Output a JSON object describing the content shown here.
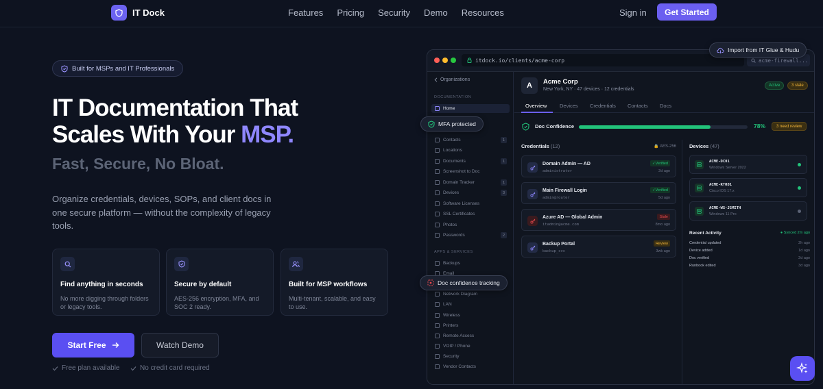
{
  "nav": {
    "brand": "IT Dock",
    "links": [
      "Features",
      "Pricing",
      "Security",
      "Demo",
      "Resources"
    ],
    "signin": "Sign in",
    "cta": "Get Started"
  },
  "hero": {
    "badge": "Built for MSPs and IT Professionals",
    "title_line1": "IT Documentation That",
    "title_line2": "Scales With Your ",
    "title_accent": "MSP.",
    "subtitle": "Fast, Secure, No Bloat.",
    "description": "Organize credentials, devices, SOPs, and client docs in one secure platform — without the complexity of legacy tools.",
    "features": [
      {
        "title": "Find anything in seconds",
        "desc": "No more digging through folders or legacy tools.",
        "icon": "search-icon"
      },
      {
        "title": "Secure by default",
        "desc": "AES-256 encryption, MFA, and SOC 2 ready.",
        "icon": "shield-icon"
      },
      {
        "title": "Built for MSP workflows",
        "desc": "Multi-tenant, scalable, and easy to use.",
        "icon": "users-icon"
      }
    ],
    "start_label": "Start Free",
    "watch_label": "Watch Demo",
    "check1": "Free plan available",
    "check2": "No credit card required"
  },
  "app": {
    "url": "itdock.io/clients/acme-corp",
    "search_placeholder": "acme-firewall...",
    "import_label": "Import from IT Glue & Hudu",
    "mfa_label": "MFA protected",
    "doc_conf_label": "Doc confidence tracking",
    "sidebar": {
      "back": "Organizations",
      "section1": "DOCUMENTATION",
      "section2": "APPS & SERVICES",
      "items1": [
        {
          "label": "Home",
          "count": ""
        },
        {
          "label": "Contacts",
          "count": "1"
        },
        {
          "label": "Locations",
          "count": ""
        },
        {
          "label": "Documents",
          "count": "1"
        },
        {
          "label": "Screenshot to Doc",
          "count": ""
        },
        {
          "label": "Domain Tracker",
          "count": "1"
        },
        {
          "label": "Devices",
          "count": "3"
        },
        {
          "label": "Software Licenses",
          "count": ""
        },
        {
          "label": "SSL Certificates",
          "count": ""
        },
        {
          "label": "Photos",
          "count": ""
        },
        {
          "label": "Passwords",
          "count": "2"
        }
      ],
      "items2": [
        "Backups",
        "Email",
        "Network Diagram",
        "LAN",
        "Wireless",
        "Printers",
        "Remote Access",
        "VOIP / Phone",
        "Security",
        "Vendor Contacts"
      ]
    },
    "org": {
      "avatar": "A",
      "name": "Acme Corp",
      "meta": "New York, NY · 47 devices · 12 credentials",
      "status_active": "Active",
      "status_stale": "3 stale"
    },
    "tabs": [
      "Overview",
      "Devices",
      "Credentials",
      "Contacts",
      "Docs"
    ],
    "confidence": {
      "label": "Doc Confidence",
      "value": 78,
      "value_text": "78%",
      "review": "3 need review"
    },
    "credentials": {
      "title": "Credentials",
      "count": "(12)",
      "aes": "AES-256",
      "rows": [
        {
          "name": "Domain Admin — AD",
          "user": "administrator",
          "status": "Verified",
          "ago": "2d ago"
        },
        {
          "name": "Main Firewall Login",
          "user": "admin@router",
          "status": "Verified",
          "ago": "5d ago"
        },
        {
          "name": "Azure AD — Global Admin",
          "user": "itadmin@acme.com",
          "status": "Stale",
          "ago": "8mo ago"
        },
        {
          "name": "Backup Portal",
          "user": "backup_svc",
          "status": "Review",
          "ago": "3wk ago"
        }
      ]
    },
    "devices": {
      "title": "Devices",
      "count": "(47)",
      "rows": [
        {
          "name": "ACME-DC01",
          "os": "Windows Server 2022",
          "online": true
        },
        {
          "name": "ACME-RTR01",
          "os": "Cisco IOS 17.x",
          "online": true
        },
        {
          "name": "ACME-WS-JSMITH",
          "os": "Windows 11 Pro",
          "online": false
        }
      ]
    },
    "recent": {
      "title": "Recent Activity",
      "sync": "Synced 2m ago",
      "rows": [
        {
          "label": "Credential updated",
          "ago": "2h ago"
        },
        {
          "label": "Device added",
          "ago": "1d ago"
        },
        {
          "label": "Doc verified",
          "ago": "2d ago"
        },
        {
          "label": "Runbook edited",
          "ago": "3d ago"
        }
      ]
    }
  },
  "colors": {
    "accent": "#6b5ff0",
    "success": "#22c37a",
    "warning": "#f2b53b",
    "danger": "#e5484d"
  }
}
